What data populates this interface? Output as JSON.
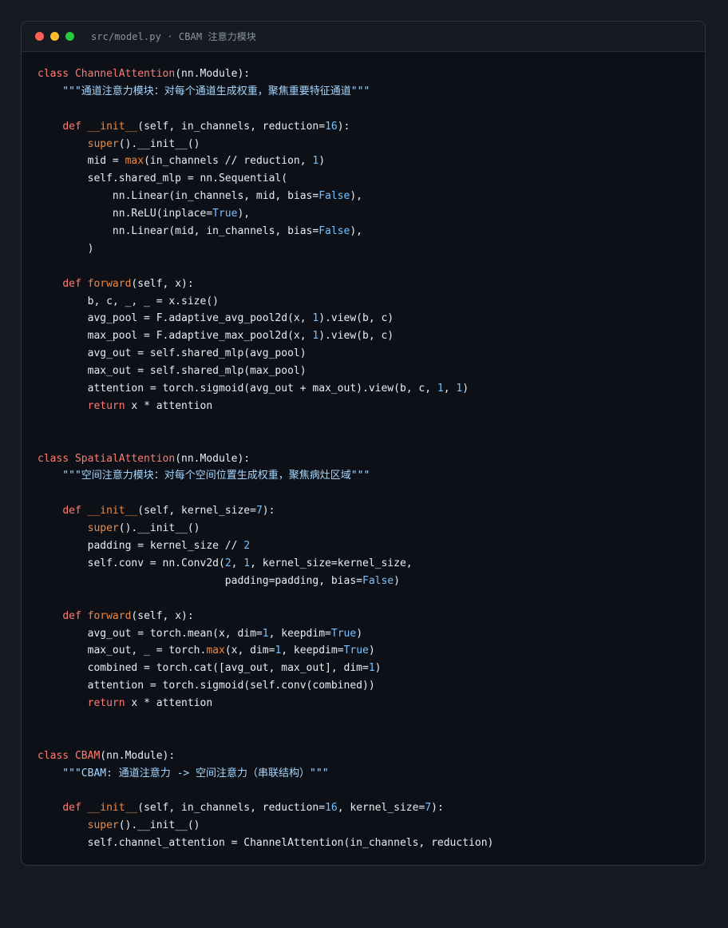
{
  "window": {
    "title": "src/model.py · CBAM 注意力模块"
  },
  "colors": {
    "page_bg": "#161b22",
    "editor_bg": "#0d1117",
    "keyword": "#ff7b72",
    "class_name": "#ff7b72",
    "function_name": "#f0883e",
    "builtin": "#f0883e",
    "number": "#79c0ff",
    "string": "#a5d6ff",
    "text": "#e6edf3",
    "traffic_red": "#ff5f57",
    "traffic_yellow": "#febc2e",
    "traffic_green": "#28c840"
  },
  "code": {
    "lines": [
      [
        {
          "t": "class ",
          "c": "kw"
        },
        {
          "t": "ChannelAttention",
          "c": "cls"
        },
        {
          "t": "(nn.Module):",
          "c": "plain"
        }
      ],
      [
        {
          "t": "    \"\"\"通道注意力模块：对每个通道生成权重，聚焦重要特征通道\"\"\"",
          "c": "str"
        }
      ],
      [],
      [
        {
          "t": "    ",
          "c": "plain"
        },
        {
          "t": "def ",
          "c": "kw"
        },
        {
          "t": "__init__",
          "c": "fn"
        },
        {
          "t": "(self, in_channels, reduction=",
          "c": "plain"
        },
        {
          "t": "16",
          "c": "num"
        },
        {
          "t": "):",
          "c": "plain"
        }
      ],
      [
        {
          "t": "        ",
          "c": "plain"
        },
        {
          "t": "super",
          "c": "bi"
        },
        {
          "t": "().__init__()",
          "c": "plain"
        }
      ],
      [
        {
          "t": "        mid = ",
          "c": "plain"
        },
        {
          "t": "max",
          "c": "bi"
        },
        {
          "t": "(in_channels // reduction, ",
          "c": "plain"
        },
        {
          "t": "1",
          "c": "num"
        },
        {
          "t": ")",
          "c": "plain"
        }
      ],
      [
        {
          "t": "        self.shared_mlp = nn.Sequential(",
          "c": "plain"
        }
      ],
      [
        {
          "t": "            nn.Linear(in_channels, mid, bias=",
          "c": "plain"
        },
        {
          "t": "False",
          "c": "num"
        },
        {
          "t": "),",
          "c": "plain"
        }
      ],
      [
        {
          "t": "            nn.ReLU(inplace=",
          "c": "plain"
        },
        {
          "t": "True",
          "c": "num"
        },
        {
          "t": "),",
          "c": "plain"
        }
      ],
      [
        {
          "t": "            nn.Linear(mid, in_channels, bias=",
          "c": "plain"
        },
        {
          "t": "False",
          "c": "num"
        },
        {
          "t": "),",
          "c": "plain"
        }
      ],
      [
        {
          "t": "        )",
          "c": "plain"
        }
      ],
      [],
      [
        {
          "t": "    ",
          "c": "plain"
        },
        {
          "t": "def ",
          "c": "kw"
        },
        {
          "t": "forward",
          "c": "fn"
        },
        {
          "t": "(self, x):",
          "c": "plain"
        }
      ],
      [
        {
          "t": "        b, c, _, _ = x.size()",
          "c": "plain"
        }
      ],
      [
        {
          "t": "        avg_pool = F.adaptive_avg_pool2d(x, ",
          "c": "plain"
        },
        {
          "t": "1",
          "c": "num"
        },
        {
          "t": ").view(b, c)",
          "c": "plain"
        }
      ],
      [
        {
          "t": "        max_pool = F.adaptive_max_pool2d(x, ",
          "c": "plain"
        },
        {
          "t": "1",
          "c": "num"
        },
        {
          "t": ").view(b, c)",
          "c": "plain"
        }
      ],
      [
        {
          "t": "        avg_out = self.shared_mlp(avg_pool)",
          "c": "plain"
        }
      ],
      [
        {
          "t": "        max_out = self.shared_mlp(max_pool)",
          "c": "plain"
        }
      ],
      [
        {
          "t": "        attention = torch.sigmoid(avg_out + max_out).view(b, c, ",
          "c": "plain"
        },
        {
          "t": "1",
          "c": "num"
        },
        {
          "t": ", ",
          "c": "plain"
        },
        {
          "t": "1",
          "c": "num"
        },
        {
          "t": ")",
          "c": "plain"
        }
      ],
      [
        {
          "t": "        ",
          "c": "plain"
        },
        {
          "t": "return ",
          "c": "kw"
        },
        {
          "t": "x * attention",
          "c": "plain"
        }
      ],
      [],
      [],
      [
        {
          "t": "class ",
          "c": "kw"
        },
        {
          "t": "SpatialAttention",
          "c": "cls"
        },
        {
          "t": "(nn.Module):",
          "c": "plain"
        }
      ],
      [
        {
          "t": "    \"\"\"空间注意力模块：对每个空间位置生成权重，聚焦病灶区域\"\"\"",
          "c": "str"
        }
      ],
      [],
      [
        {
          "t": "    ",
          "c": "plain"
        },
        {
          "t": "def ",
          "c": "kw"
        },
        {
          "t": "__init__",
          "c": "fn"
        },
        {
          "t": "(self, kernel_size=",
          "c": "plain"
        },
        {
          "t": "7",
          "c": "num"
        },
        {
          "t": "):",
          "c": "plain"
        }
      ],
      [
        {
          "t": "        ",
          "c": "plain"
        },
        {
          "t": "super",
          "c": "bi"
        },
        {
          "t": "().__init__()",
          "c": "plain"
        }
      ],
      [
        {
          "t": "        padding = kernel_size // ",
          "c": "plain"
        },
        {
          "t": "2",
          "c": "num"
        }
      ],
      [
        {
          "t": "        self.conv = nn.Conv2d(",
          "c": "plain"
        },
        {
          "t": "2",
          "c": "num"
        },
        {
          "t": ", ",
          "c": "plain"
        },
        {
          "t": "1",
          "c": "num"
        },
        {
          "t": ", kernel_size=kernel_size,",
          "c": "plain"
        }
      ],
      [
        {
          "t": "                              padding=padding, bias=",
          "c": "plain"
        },
        {
          "t": "False",
          "c": "num"
        },
        {
          "t": ")",
          "c": "plain"
        }
      ],
      [],
      [
        {
          "t": "    ",
          "c": "plain"
        },
        {
          "t": "def ",
          "c": "kw"
        },
        {
          "t": "forward",
          "c": "fn"
        },
        {
          "t": "(self, x):",
          "c": "plain"
        }
      ],
      [
        {
          "t": "        avg_out = torch.mean(x, dim=",
          "c": "plain"
        },
        {
          "t": "1",
          "c": "num"
        },
        {
          "t": ", keepdim=",
          "c": "plain"
        },
        {
          "t": "True",
          "c": "num"
        },
        {
          "t": ")",
          "c": "plain"
        }
      ],
      [
        {
          "t": "        max_out, _ = torch.",
          "c": "plain"
        },
        {
          "t": "max",
          "c": "bi"
        },
        {
          "t": "(x, dim=",
          "c": "plain"
        },
        {
          "t": "1",
          "c": "num"
        },
        {
          "t": ", keepdim=",
          "c": "plain"
        },
        {
          "t": "True",
          "c": "num"
        },
        {
          "t": ")",
          "c": "plain"
        }
      ],
      [
        {
          "t": "        combined = torch.cat([avg_out, max_out], dim=",
          "c": "plain"
        },
        {
          "t": "1",
          "c": "num"
        },
        {
          "t": ")",
          "c": "plain"
        }
      ],
      [
        {
          "t": "        attention = torch.sigmoid(self.conv(combined))",
          "c": "plain"
        }
      ],
      [
        {
          "t": "        ",
          "c": "plain"
        },
        {
          "t": "return ",
          "c": "kw"
        },
        {
          "t": "x * attention",
          "c": "plain"
        }
      ],
      [],
      [],
      [
        {
          "t": "class ",
          "c": "kw"
        },
        {
          "t": "CBAM",
          "c": "cls"
        },
        {
          "t": "(nn.Module):",
          "c": "plain"
        }
      ],
      [
        {
          "t": "    \"\"\"CBAM: 通道注意力 -> 空间注意力（串联结构）\"\"\"",
          "c": "str"
        }
      ],
      [],
      [
        {
          "t": "    ",
          "c": "plain"
        },
        {
          "t": "def ",
          "c": "kw"
        },
        {
          "t": "__init__",
          "c": "fn"
        },
        {
          "t": "(self, in_channels, reduction=",
          "c": "plain"
        },
        {
          "t": "16",
          "c": "num"
        },
        {
          "t": ", kernel_size=",
          "c": "plain"
        },
        {
          "t": "7",
          "c": "num"
        },
        {
          "t": "):",
          "c": "plain"
        }
      ],
      [
        {
          "t": "        ",
          "c": "plain"
        },
        {
          "t": "super",
          "c": "bi"
        },
        {
          "t": "().__init__()",
          "c": "plain"
        }
      ],
      [
        {
          "t": "        self.channel_attention = ChannelAttention(in_channels, reduction)",
          "c": "plain"
        }
      ]
    ]
  }
}
